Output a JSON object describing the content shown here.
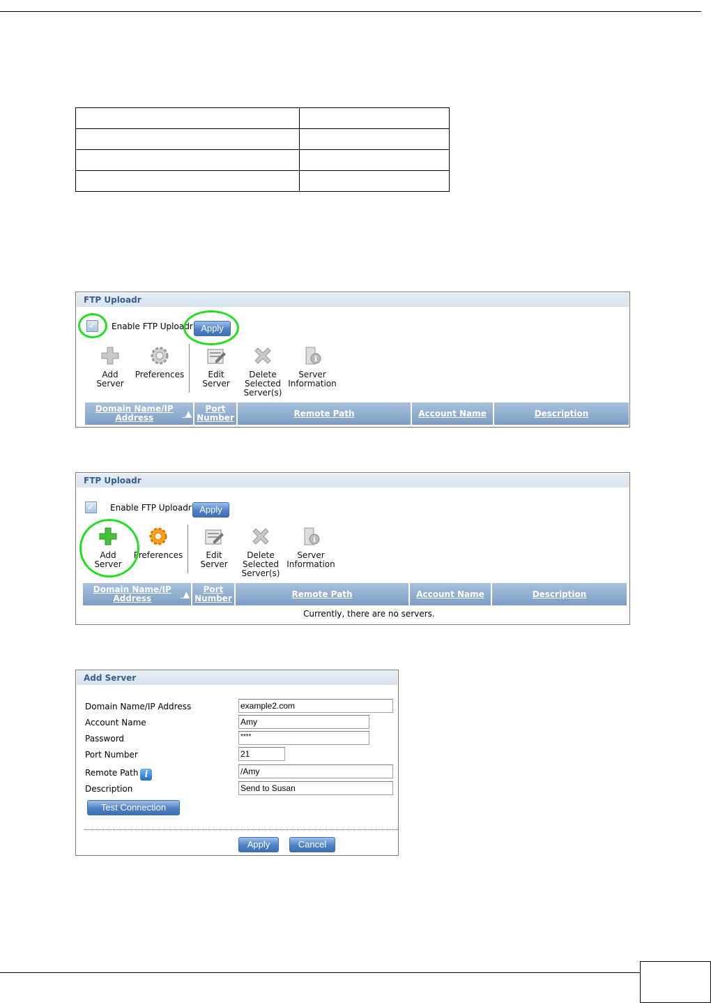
{
  "panel1": {
    "title": "FTP Uploadr",
    "enable_label": "Enable FTP Uploadr",
    "apply_label": "Apply",
    "toolbar": [
      {
        "line1": "Add",
        "line2": "Server",
        "line3": ""
      },
      {
        "line1": "Preferences",
        "line2": "",
        "line3": ""
      },
      {
        "line1": "Edit",
        "line2": "Server",
        "line3": ""
      },
      {
        "line1": "Delete",
        "line2": "Selected",
        "line3": "Server(s)"
      },
      {
        "line1": "Server",
        "line2": "Information",
        "line3": ""
      }
    ],
    "columns": [
      "Domain Name/IP Address",
      "Port Number",
      "Remote Path",
      "Account Name",
      "Description"
    ]
  },
  "panel2": {
    "title": "FTP Uploadr",
    "enable_label": "Enable FTP Uploadr",
    "apply_label": "Apply",
    "toolbar": [
      {
        "line1": "Add",
        "line2": "Server",
        "line3": ""
      },
      {
        "line1": "Preferences",
        "line2": "",
        "line3": ""
      },
      {
        "line1": "Edit",
        "line2": "Server",
        "line3": ""
      },
      {
        "line1": "Delete",
        "line2": "Selected",
        "line3": "Server(s)"
      },
      {
        "line1": "Server",
        "line2": "Information",
        "line3": ""
      }
    ],
    "columns": [
      "Domain Name/IP Address",
      "Port Number",
      "Remote Path",
      "Account Name",
      "Description"
    ],
    "empty_message": "Currently, there are no servers."
  },
  "add_server": {
    "title": "Add Server",
    "fields": {
      "domain": {
        "label": "Domain Name/IP Address",
        "value": "example2.com"
      },
      "account": {
        "label": "Account Name",
        "value": "Amy"
      },
      "password": {
        "label": "Password",
        "value": "****"
      },
      "port": {
        "label": "Port Number",
        "value": "21"
      },
      "remote_path": {
        "label": "Remote Path",
        "value": "/Amy"
      },
      "description": {
        "label": "Description",
        "value": "Send to Susan"
      }
    },
    "test_connection_label": "Test Connection",
    "apply_label": "Apply",
    "cancel_label": "Cancel"
  },
  "colors": {
    "highlight_ring": "#22dd22",
    "header_blue": "#7b9dc4",
    "title_text": "#355e8a"
  }
}
